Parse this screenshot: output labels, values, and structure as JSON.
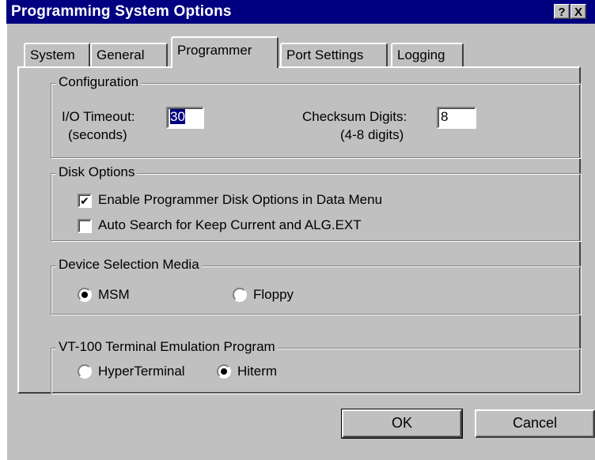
{
  "window": {
    "title": "Programming System Options",
    "help_label": "?",
    "close_label": "X"
  },
  "tabs": [
    {
      "label": "System",
      "active": false
    },
    {
      "label": "General",
      "active": false
    },
    {
      "label": "Programmer",
      "active": true
    },
    {
      "label": "Port Settings",
      "active": false
    },
    {
      "label": "Logging",
      "active": false
    }
  ],
  "configuration": {
    "group_label": "Configuration",
    "io_timeout": {
      "label": "I/O Timeout:",
      "sublabel": "(seconds)",
      "value": "30"
    },
    "checksum_digits": {
      "label": "Checksum Digits:",
      "sublabel": "(4-8 digits)",
      "value": "8"
    }
  },
  "disk_options": {
    "group_label": "Disk Options",
    "enable_disk_options": {
      "label": "Enable Programmer Disk Options in Data Menu",
      "checked": true,
      "mark": "✔"
    },
    "auto_search": {
      "label": "Auto Search for Keep Current and ALG.EXT",
      "checked": false
    }
  },
  "device_selection": {
    "group_label": "Device Selection Media",
    "options": [
      {
        "label": "MSM",
        "selected": true
      },
      {
        "label": "Floppy",
        "selected": false
      }
    ]
  },
  "vt100": {
    "group_label": "VT-100 Terminal Emulation Program",
    "options": [
      {
        "label": "HyperTerminal",
        "selected": false
      },
      {
        "label": "Hiterm",
        "selected": true
      }
    ]
  },
  "buttons": {
    "ok": "OK",
    "cancel": "Cancel"
  },
  "colors": {
    "title_bar": "#000080",
    "face": "#c0c0c0",
    "selection": "#000080"
  }
}
